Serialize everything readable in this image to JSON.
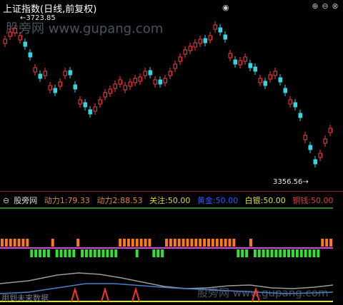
{
  "title": "上证指数(日线,前复权)",
  "window_controls": [
    "plus-icon",
    "minus-icon",
    "close-icon"
  ],
  "price_high_label": "3723.85",
  "price_low_label": "3356.56",
  "watermark_text": "股旁网 www.gupang.com",
  "indicator": {
    "name": "股旁网",
    "items": [
      {
        "label": "动力1:",
        "value": "79.33",
        "color": "#e08a2c"
      },
      {
        "label": "动力2:",
        "value": "88.53",
        "color": "#e08a2c"
      },
      {
        "label": "关注:",
        "value": "50.00",
        "color": "#e0d040"
      },
      {
        "label": "黄金:",
        "value": "50.00",
        "color": "#2c5cff"
      },
      {
        "label": "白银:",
        "value": "50.00",
        "color": "#e0e040"
      },
      {
        "label": "铜钱:",
        "value": "50.00",
        "color": "#e04040"
      }
    ]
  },
  "footer_text": "用到未来数据",
  "colors": {
    "up": "#ff3b3b",
    "down": "#33d6e0",
    "orange_bar": "#ff7a1a",
    "green_bar": "#33e033",
    "magenta_line": "#e040e0",
    "green_line": "#22c022",
    "yellow_line": "#e0e040"
  }
}
